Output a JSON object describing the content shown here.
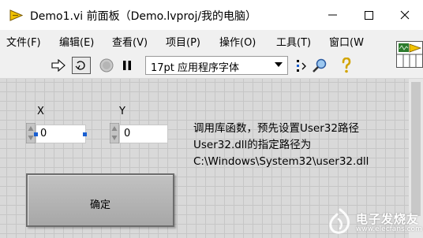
{
  "window": {
    "title": "Demo1.vi 前面板（Demo.lvproj/我的电脑）",
    "icon": "labview-vi-icon"
  },
  "menu": {
    "items": [
      "文件(F)",
      "编辑(E)",
      "查看(V)",
      "项目(P)",
      "操作(O)",
      "工具(T)",
      "窗口(W"
    ]
  },
  "toolbar": {
    "font_select": "17pt 应用程序字体",
    "icons": [
      "run-arrow-icon",
      "run-continuously-icon",
      "abort-icon",
      "pause-icon",
      "align-icon",
      "search-icon",
      "help-icon",
      "vi-connector-icon"
    ]
  },
  "controls": {
    "x": {
      "label": "X",
      "value": "0"
    },
    "y": {
      "label": "Y",
      "value": "0"
    },
    "ok_button": "确定"
  },
  "description": {
    "lines": [
      "调用库函数，预先设置User32路径",
      "User32.dll的指定路径为",
      "C:\\Windows\\System32\\user32.dll"
    ]
  },
  "watermark": {
    "text_cn": "电子发烧友",
    "text_en": "www.elecfans.com"
  },
  "colors": {
    "panel_bg": "#d9d9d9",
    "grid": "#c6c6c6",
    "menu_bg": "#f0f0f0",
    "button_face": "#b4b4b4",
    "vi_icon_yellow": "#f2c200"
  }
}
